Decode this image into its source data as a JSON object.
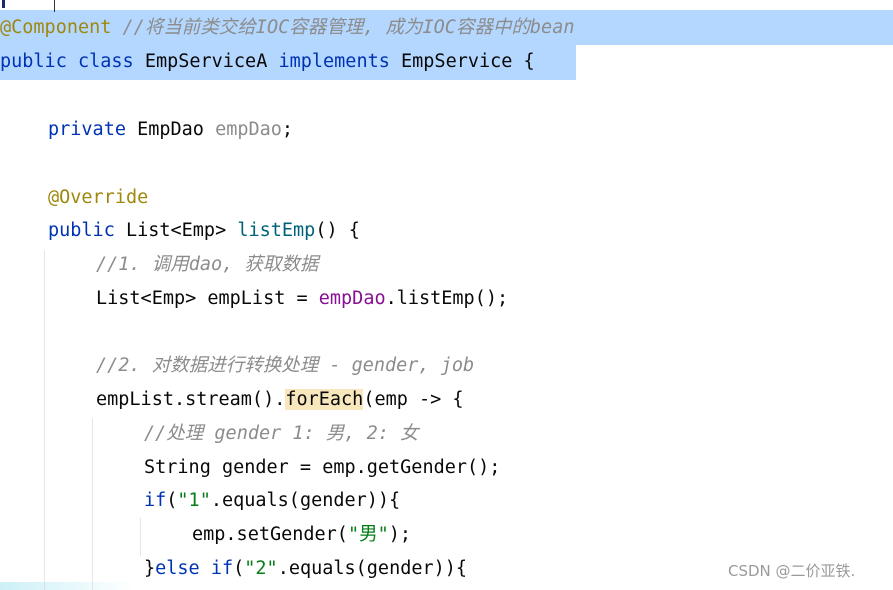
{
  "code": {
    "l1": {
      "annotation": "@Component",
      "comment": "//将当前类交给IOC容器管理, 成为IOC容器中的bean"
    },
    "l2": {
      "kw1": "public",
      "kw2": "class",
      "cls": "EmpServiceA",
      "kw3": "implements",
      "iface": "EmpService",
      "brace": "{"
    },
    "l3": {
      "kw": "private",
      "type": "EmpDao",
      "field": "empDao",
      "semi": ";"
    },
    "l4": {
      "annotation": "@Override"
    },
    "l5": {
      "kw": "public",
      "ret": "List<Emp>",
      "method": "listEmp",
      "rest": "() {"
    },
    "l6": {
      "comment": "//1. 调用dao, 获取数据"
    },
    "l7": {
      "pre": "List<Emp> empList = ",
      "field": "empDao",
      "post": ".listEmp();"
    },
    "l8": {
      "comment": "//2. 对数据进行转换处理 - gender, job"
    },
    "l9": {
      "pre": "empList.stream().",
      "hl": "forEach",
      "post": "(emp -> {"
    },
    "l10": {
      "comment": "//处理 gender 1: 男, 2: 女"
    },
    "l11": {
      "text": "String gender = emp.getGender();"
    },
    "l12": {
      "kw": "if",
      "p1": "(",
      "str": "\"1\"",
      "p2": ".equals(gender)){"
    },
    "l13": {
      "pre": "emp.setGender(",
      "str": "\"男\"",
      "post": ");"
    },
    "l14": {
      "pre": "}",
      "kw1": "else",
      "sp": " ",
      "kw2": "if",
      "p1": "(",
      "str": "\"2\"",
      "p2": ".equals(gender)){"
    }
  },
  "watermark": "CSDN @二价亚铁."
}
